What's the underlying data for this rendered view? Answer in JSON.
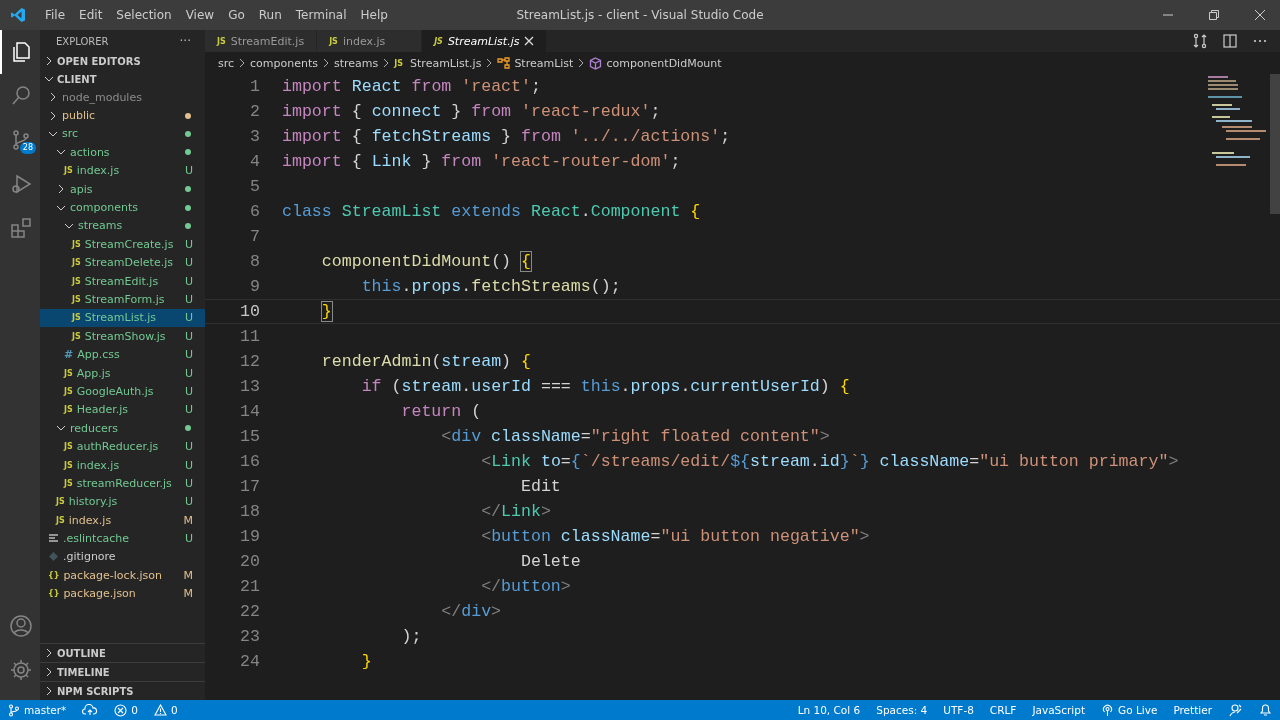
{
  "window": {
    "title": "StreamList.js - client - Visual Studio Code"
  },
  "menu": [
    "File",
    "Edit",
    "Selection",
    "View",
    "Go",
    "Run",
    "Terminal",
    "Help"
  ],
  "activity_bar": {
    "top": [
      {
        "kind": "explorer",
        "selected": true
      },
      {
        "kind": "search",
        "selected": false
      },
      {
        "kind": "scm",
        "badge": "28",
        "selected": false
      },
      {
        "kind": "debug",
        "selected": false
      },
      {
        "kind": "extensions",
        "selected": false
      }
    ],
    "bottom": [
      {
        "kind": "account"
      },
      {
        "kind": "settings"
      }
    ]
  },
  "sidebar": {
    "title": "EXPLORER",
    "more": "···",
    "open_editors": "OPEN EDITORS",
    "root": "CLIENT",
    "tree": [
      {
        "name": "node_modules",
        "kind": "folder",
        "expanded": false,
        "selected": false,
        "color": "#8c8c8c"
      },
      {
        "name": "public",
        "kind": "folder",
        "expanded": false,
        "selected": false,
        "color": "#e2c08d",
        "dot": true
      },
      {
        "name": "src",
        "kind": "folder",
        "expanded": true,
        "selected": false,
        "color": "#73c991",
        "dot": true,
        "children": [
          {
            "name": "actions",
            "kind": "folder",
            "expanded": true,
            "selected": false,
            "color": "#73c991",
            "dot": true,
            "children": [
              {
                "name": "index.js",
                "kind": "file",
                "icon": "JS",
                "badge": "U",
                "selected": false,
                "color": "#73c991"
              }
            ]
          },
          {
            "name": "apis",
            "kind": "folder",
            "expanded": false,
            "selected": false,
            "color": "#73c991",
            "dot": true
          },
          {
            "name": "components",
            "kind": "folder",
            "expanded": true,
            "selected": false,
            "color": "#73c991",
            "dot": true,
            "children": [
              {
                "name": "streams",
                "kind": "folder",
                "expanded": true,
                "selected": false,
                "color": "#73c991",
                "dot": true,
                "children": [
                  {
                    "name": "StreamCreate.js",
                    "kind": "file",
                    "icon": "JS",
                    "badge": "U",
                    "selected": false,
                    "color": "#73c991"
                  },
                  {
                    "name": "StreamDelete.js",
                    "kind": "file",
                    "icon": "JS",
                    "badge": "U",
                    "selected": false,
                    "color": "#73c991"
                  },
                  {
                    "name": "StreamEdit.js",
                    "kind": "file",
                    "icon": "JS",
                    "badge": "U",
                    "selected": false,
                    "color": "#73c991"
                  },
                  {
                    "name": "StreamForm.js",
                    "kind": "file",
                    "icon": "JS",
                    "badge": "U",
                    "selected": false,
                    "color": "#73c991"
                  },
                  {
                    "name": "StreamList.js",
                    "kind": "file",
                    "icon": "JS",
                    "badge": "U",
                    "selected": true,
                    "color": "#73c991"
                  },
                  {
                    "name": "StreamShow.js",
                    "kind": "file",
                    "icon": "JS",
                    "badge": "U",
                    "selected": false,
                    "color": "#73c991"
                  }
                ]
              },
              {
                "name": "App.css",
                "kind": "file",
                "icon": "#",
                "badge": "U",
                "selected": false,
                "color": "#73c991"
              },
              {
                "name": "App.js",
                "kind": "file",
                "icon": "JS",
                "badge": "U",
                "selected": false,
                "color": "#73c991"
              },
              {
                "name": "GoogleAuth.js",
                "kind": "file",
                "icon": "JS",
                "badge": "U",
                "selected": false,
                "color": "#73c991"
              },
              {
                "name": "Header.js",
                "kind": "file",
                "icon": "JS",
                "badge": "U",
                "selected": false,
                "color": "#73c991"
              }
            ]
          },
          {
            "name": "reducers",
            "kind": "folder",
            "expanded": true,
            "selected": false,
            "color": "#73c991",
            "dot": true,
            "children": [
              {
                "name": "authReducer.js",
                "kind": "file",
                "icon": "JS",
                "badge": "U",
                "selected": false,
                "color": "#73c991"
              },
              {
                "name": "index.js",
                "kind": "file",
                "icon": "JS",
                "badge": "U",
                "selected": false,
                "color": "#73c991"
              },
              {
                "name": "streamReducer.js",
                "kind": "file",
                "icon": "JS",
                "badge": "U",
                "selected": false,
                "color": "#73c991"
              }
            ]
          },
          {
            "name": "history.js",
            "kind": "file",
            "icon": "JS",
            "badge": "U",
            "selected": false,
            "color": "#73c991"
          },
          {
            "name": "index.js",
            "kind": "file",
            "icon": "JS",
            "badge": "M",
            "selected": false,
            "color": "#e2c08d"
          }
        ]
      },
      {
        "name": ".eslintcache",
        "kind": "lines",
        "badge": "U",
        "selected": false,
        "color": "#73c991"
      },
      {
        "name": ".gitignore",
        "kind": "git",
        "selected": false,
        "color": "#cccccc"
      },
      {
        "name": "package-lock.json",
        "kind": "file",
        "icon": "{}",
        "badge": "M",
        "selected": false,
        "color": "#e2c08d"
      },
      {
        "name": "package.json",
        "kind": "file",
        "icon": "{}",
        "badge": "M",
        "selected": false,
        "color": "#e2c08d"
      }
    ],
    "sections": [
      "OUTLINE",
      "TIMELINE",
      "NPM SCRIPTS"
    ]
  },
  "tabs": [
    {
      "label": "StreamEdit.js",
      "icon": "JS",
      "selected": false
    },
    {
      "label": "index.js",
      "icon": "JS",
      "selected": false
    },
    {
      "label": "StreamList.js",
      "icon": "JS",
      "selected": true
    }
  ],
  "breadcrumbs": [
    {
      "kind": "folder",
      "text": "src"
    },
    {
      "kind": "folder",
      "text": "components"
    },
    {
      "kind": "folder",
      "text": "streams"
    },
    {
      "kind": "file",
      "icon": "JS",
      "text": "StreamList.js"
    },
    {
      "kind": "class",
      "text": "StreamList"
    },
    {
      "kind": "method",
      "text": "componentDidMount"
    }
  ],
  "editor": {
    "lines": [
      {
        "number": "1",
        "current": false,
        "tokens": [
          {
            "kind": "ctl",
            "text": "import "
          },
          {
            "kind": "var",
            "text": "React"
          },
          {
            "kind": "ctl",
            "text": " from "
          },
          {
            "kind": "str",
            "text": "'react'"
          },
          {
            "kind": "punct",
            "text": ";"
          }
        ]
      },
      {
        "number": "2",
        "current": false,
        "tokens": [
          {
            "kind": "ctl",
            "text": "import "
          },
          {
            "kind": "punct",
            "text": "{ "
          },
          {
            "kind": "var",
            "text": "connect"
          },
          {
            "kind": "punct",
            "text": " } "
          },
          {
            "kind": "ctl",
            "text": "from "
          },
          {
            "kind": "str",
            "text": "'react-redux'"
          },
          {
            "kind": "punct",
            "text": ";"
          }
        ]
      },
      {
        "number": "3",
        "current": false,
        "tokens": [
          {
            "kind": "ctl",
            "text": "import "
          },
          {
            "kind": "punct",
            "text": "{ "
          },
          {
            "kind": "var",
            "text": "fetchStreams"
          },
          {
            "kind": "punct",
            "text": " } "
          },
          {
            "kind": "ctl",
            "text": "from "
          },
          {
            "kind": "str",
            "text": "'../../actions'"
          },
          {
            "kind": "punct",
            "text": ";"
          }
        ]
      },
      {
        "number": "4",
        "current": false,
        "tokens": [
          {
            "kind": "ctl",
            "text": "import "
          },
          {
            "kind": "punct",
            "text": "{ "
          },
          {
            "kind": "var",
            "text": "Link"
          },
          {
            "kind": "punct",
            "text": " } "
          },
          {
            "kind": "ctl",
            "text": "from "
          },
          {
            "kind": "str",
            "text": "'react-router-dom'"
          },
          {
            "kind": "punct",
            "text": ";"
          }
        ]
      },
      {
        "number": "5",
        "current": false
      },
      {
        "number": "6",
        "current": false,
        "tokens": [
          {
            "kind": "kw",
            "text": "class "
          },
          {
            "kind": "type",
            "text": "StreamList"
          },
          {
            "kind": "kw",
            "text": " extends "
          },
          {
            "kind": "type",
            "text": "React"
          },
          {
            "kind": "punct",
            "text": "."
          },
          {
            "kind": "type",
            "text": "Component"
          },
          {
            "kind": "brace",
            "text": " {"
          }
        ]
      },
      {
        "number": "7",
        "current": false
      },
      {
        "number": "8",
        "current": false,
        "tokens": [
          {
            "kind": "fn",
            "text": "    componentDidMount"
          },
          {
            "kind": "punct",
            "text": "() "
          },
          {
            "kind": "match",
            "text": "{"
          }
        ]
      },
      {
        "number": "9",
        "current": false,
        "tokens": [
          {
            "kind": "kw",
            "text": "        this"
          },
          {
            "kind": "punct",
            "text": "."
          },
          {
            "kind": "var",
            "text": "props"
          },
          {
            "kind": "punct",
            "text": "."
          },
          {
            "kind": "fn",
            "text": "fetchStreams"
          },
          {
            "kind": "punct",
            "text": "();"
          }
        ]
      },
      {
        "number": "10",
        "current": true,
        "tokens": [
          {
            "kind": "match",
            "text": "    }"
          }
        ]
      },
      {
        "number": "11",
        "current": false
      },
      {
        "number": "12",
        "current": false,
        "tokens": [
          {
            "kind": "fn",
            "text": "    renderAdmin"
          },
          {
            "kind": "punct",
            "text": "("
          },
          {
            "kind": "var",
            "text": "stream"
          },
          {
            "kind": "punct",
            "text": ") "
          },
          {
            "kind": "brace",
            "text": "{"
          }
        ]
      },
      {
        "number": "13",
        "current": false,
        "tokens": [
          {
            "kind": "ctl",
            "text": "        if "
          },
          {
            "kind": "punct",
            "text": "("
          },
          {
            "kind": "var",
            "text": "stream"
          },
          {
            "kind": "punct",
            "text": "."
          },
          {
            "kind": "var",
            "text": "userId"
          },
          {
            "kind": "punct",
            "text": " === "
          },
          {
            "kind": "kw",
            "text": "this"
          },
          {
            "kind": "punct",
            "text": "."
          },
          {
            "kind": "var",
            "text": "props"
          },
          {
            "kind": "punct",
            "text": "."
          },
          {
            "kind": "var",
            "text": "currentUserId"
          },
          {
            "kind": "punct",
            "text": ") "
          },
          {
            "kind": "brace",
            "text": "{"
          }
        ]
      },
      {
        "number": "14",
        "current": false,
        "tokens": [
          {
            "kind": "ctl",
            "text": "            return "
          },
          {
            "kind": "punct",
            "text": "("
          }
        ]
      },
      {
        "number": "15",
        "current": false,
        "tokens": [
          {
            "kind": "angle",
            "text": "                <"
          },
          {
            "kind": "kw",
            "text": "div"
          },
          {
            "kind": "var",
            "text": " className"
          },
          {
            "kind": "punct",
            "text": "="
          },
          {
            "kind": "str",
            "text": "\"right floated content\""
          },
          {
            "kind": "angle",
            "text": ">"
          }
        ]
      },
      {
        "number": "16",
        "current": false,
        "tokens": [
          {
            "kind": "angle",
            "text": "                    <"
          },
          {
            "kind": "type",
            "text": "Link"
          },
          {
            "kind": "var",
            "text": " to"
          },
          {
            "kind": "punct",
            "text": "="
          },
          {
            "kind": "kw",
            "text": "{"
          },
          {
            "kind": "str",
            "text": "`/streams/edit/"
          },
          {
            "kind": "kw",
            "text": "${"
          },
          {
            "kind": "var",
            "text": "stream"
          },
          {
            "kind": "punct",
            "text": "."
          },
          {
            "kind": "var",
            "text": "id"
          },
          {
            "kind": "kw",
            "text": "}"
          },
          {
            "kind": "str",
            "text": "`"
          },
          {
            "kind": "kw",
            "text": "}"
          },
          {
            "kind": "var",
            "text": " className"
          },
          {
            "kind": "punct",
            "text": "="
          },
          {
            "kind": "str",
            "text": "\"ui button primary\""
          },
          {
            "kind": "angle",
            "text": ">"
          }
        ]
      },
      {
        "number": "17",
        "current": false,
        "tokens": [
          {
            "kind": "text",
            "text": "                        Edit"
          }
        ]
      },
      {
        "number": "18",
        "current": false,
        "tokens": [
          {
            "kind": "angle",
            "text": "                    </"
          },
          {
            "kind": "type",
            "text": "Link"
          },
          {
            "kind": "angle",
            "text": ">"
          }
        ]
      },
      {
        "number": "19",
        "current": false,
        "tokens": [
          {
            "kind": "angle",
            "text": "                    <"
          },
          {
            "kind": "kw",
            "text": "button"
          },
          {
            "kind": "var",
            "text": " className"
          },
          {
            "kind": "punct",
            "text": "="
          },
          {
            "kind": "str",
            "text": "\"ui button negative\""
          },
          {
            "kind": "angle",
            "text": ">"
          }
        ]
      },
      {
        "number": "20",
        "current": false,
        "tokens": [
          {
            "kind": "text",
            "text": "                        Delete"
          }
        ]
      },
      {
        "number": "21",
        "current": false,
        "tokens": [
          {
            "kind": "angle",
            "text": "                    </"
          },
          {
            "kind": "kw",
            "text": "button"
          },
          {
            "kind": "angle",
            "text": ">"
          }
        ]
      },
      {
        "number": "22",
        "current": false,
        "tokens": [
          {
            "kind": "angle",
            "text": "                </"
          },
          {
            "kind": "kw",
            "text": "div"
          },
          {
            "kind": "angle",
            "text": ">"
          }
        ]
      },
      {
        "number": "23",
        "current": false,
        "tokens": [
          {
            "kind": "punct",
            "text": "            );"
          }
        ]
      },
      {
        "number": "24",
        "current": false,
        "tokens": [
          {
            "kind": "brace",
            "text": "        }"
          }
        ]
      }
    ]
  },
  "status_bar": {
    "left": [
      {
        "kind": "branch",
        "text": "master*"
      },
      {
        "kind": "sync"
      },
      {
        "kind": "errors",
        "text": "0"
      },
      {
        "kind": "warnings",
        "text": "0"
      }
    ],
    "right": [
      {
        "kind": "text",
        "text": "Ln 10, Col 6"
      },
      {
        "kind": "text",
        "text": "Spaces: 4"
      },
      {
        "kind": "text",
        "text": "UTF-8"
      },
      {
        "kind": "text",
        "text": "CRLF"
      },
      {
        "kind": "text",
        "text": "JavaScript"
      },
      {
        "kind": "live",
        "text": "Go Live"
      },
      {
        "kind": "text",
        "text": "Prettier"
      },
      {
        "kind": "feedback"
      },
      {
        "kind": "bell"
      }
    ]
  }
}
